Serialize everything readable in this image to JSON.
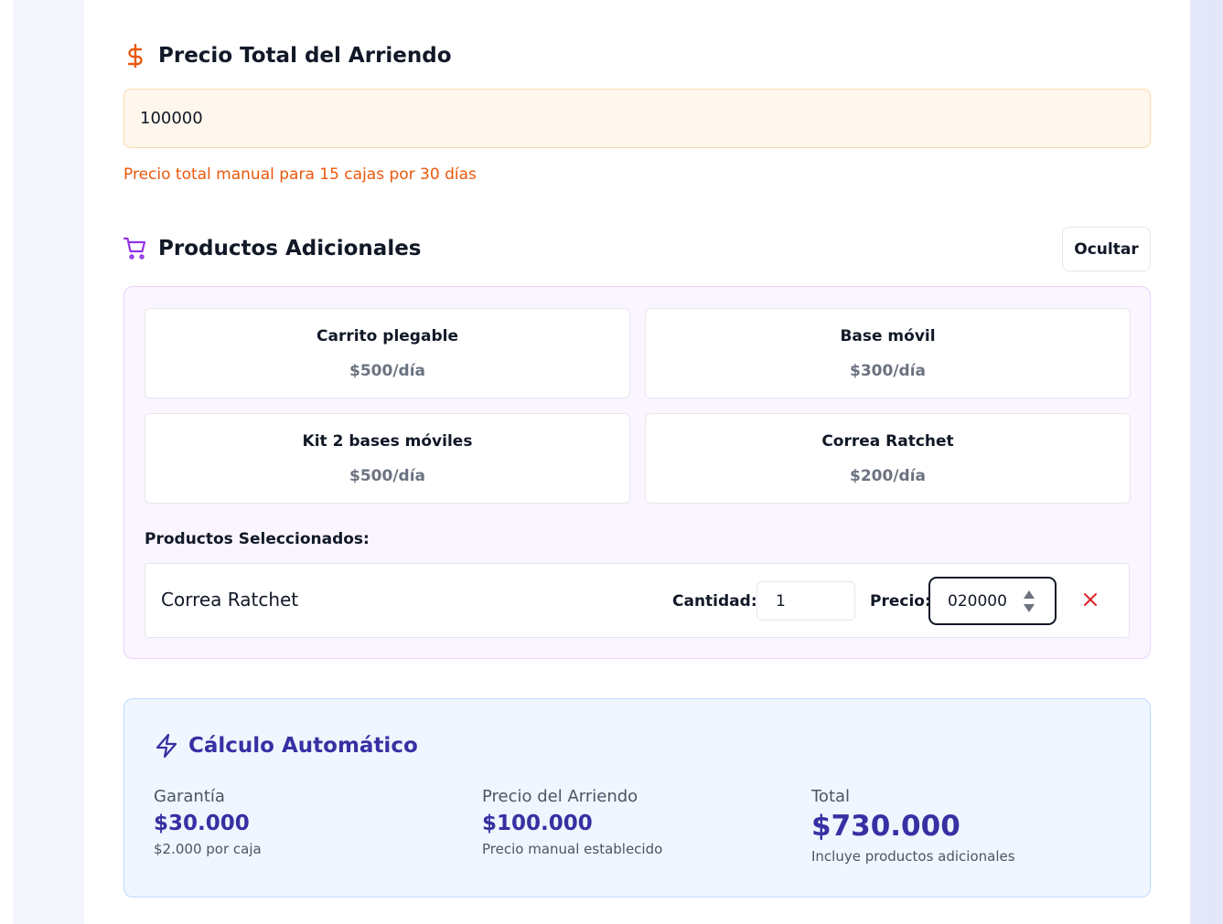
{
  "price_section": {
    "title": "Precio Total del Arriendo",
    "input_value": "100000",
    "help_text": "Precio total manual para 15 cajas por 30 días"
  },
  "products_section": {
    "title": "Productos Adicionales",
    "toggle_label": "Ocultar",
    "catalog": [
      {
        "name": "Carrito plegable",
        "rate": "$500/día"
      },
      {
        "name": "Base móvil",
        "rate": "$300/día"
      },
      {
        "name": "Kit 2 bases móviles",
        "rate": "$500/día"
      },
      {
        "name": "Correa Ratchet",
        "rate": "$200/día"
      }
    ],
    "selected_title": "Productos Seleccionados:",
    "selected": [
      {
        "name": "Correa Ratchet",
        "qty_label": "Cantidad:",
        "qty": "1",
        "price_label": "Precio:",
        "price": "020000"
      }
    ]
  },
  "calc_section": {
    "title": "Cálculo Automático",
    "guarantee": {
      "label": "Garantía",
      "value": "$30.000",
      "sub": "$2.000 por caja"
    },
    "rent": {
      "label": "Precio del Arriendo",
      "value": "$100.000",
      "sub": "Precio manual establecido"
    },
    "total": {
      "label": "Total",
      "value": "$730.000",
      "sub": "Incluye productos adicionales"
    }
  },
  "colors": {
    "accent_orange": "#ea580c",
    "accent_purple": "#9333ea",
    "accent_indigo": "#3730a3",
    "danger": "#dc2626"
  }
}
